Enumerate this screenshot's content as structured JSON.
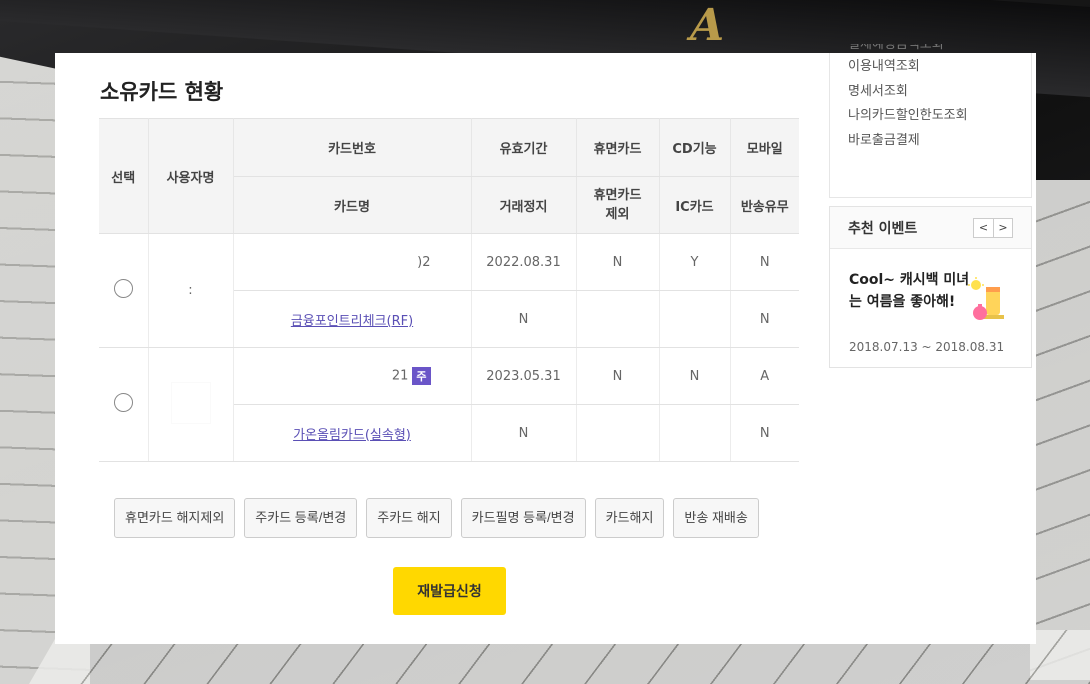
{
  "page_title": "소유카드 현황",
  "table": {
    "header_row1": [
      "선택",
      "사용자명",
      "카드번호",
      "유효기간",
      "휴면카드",
      "CD기능",
      "모바일"
    ],
    "header_row2": [
      "카드명",
      "거래정지",
      "휴면카드\n제외",
      "IC카드",
      "반송유무"
    ],
    "rows": [
      {
        "user": ":",
        "card_number": ")2",
        "expiry": "2022.08.31",
        "dormant": "N",
        "cd": "Y",
        "mobile": "N",
        "card_name": "금융포인트리체크(RF)",
        "suspended": "N",
        "dormant_excl": "",
        "ic": "",
        "returned": "N"
      },
      {
        "user": "",
        "card_number": "21",
        "badge": "주",
        "expiry": "2023.05.31",
        "dormant": "N",
        "cd": "N",
        "mobile": "A",
        "card_name": "가온올림카드(실속형)",
        "suspended": "N",
        "dormant_excl": "",
        "ic": "",
        "returned": "N"
      }
    ]
  },
  "buttons": [
    "휴면카드 해지제외",
    "주카드 등록/변경",
    "주카드 해지",
    "카드필명 등록/변경",
    "카드해지",
    "반송 재배송"
  ],
  "reissue_label": "재발급신청",
  "side_menu": [
    "결제예정금액조회",
    "이용내역조회",
    "명세서조회",
    "나의카드할인한도조회",
    "바로출금결제"
  ],
  "event": {
    "title": "추천 이벤트",
    "prev": "<",
    "next": ">",
    "text": "Cool~ 캐시백 미녀는 여름을 좋아해!",
    "period": "2018.07.13 ~ 2018.08.31"
  },
  "background_text": "A"
}
